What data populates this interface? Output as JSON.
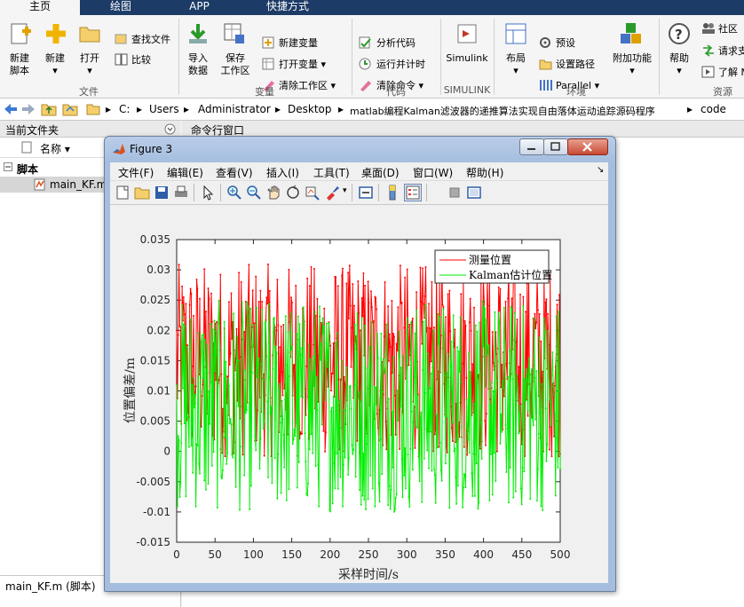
{
  "ribbon_tabs": [
    "主页",
    "绘图",
    "APP",
    "快捷方式"
  ],
  "home": {
    "new_script": [
      "新建",
      "脚本"
    ],
    "new": "新建",
    "open": "打开",
    "find_files": "查找文件",
    "compare": "比较",
    "import": [
      "导入",
      "数据"
    ],
    "save_workspace": [
      "保存",
      "工作区"
    ],
    "new_variable": "新建变量",
    "open_variable": "打开变量",
    "clear_workspace": "清除工作区",
    "analyze_code": "分析代码",
    "run_and_time": "运行并计时",
    "clear_commands": "清除命令",
    "simulink": "Simulink",
    "layout": "布局",
    "preferences": "预设",
    "set_path": "设置路径",
    "parallel": "Parallel",
    "addons": "附加功能",
    "help": "帮助",
    "community": "社区",
    "request_support": "请求支",
    "learn": "了解 M",
    "groups": [
      "文件",
      "变量",
      "代码",
      "SIMULINK",
      "环境",
      "资源"
    ]
  },
  "address": {
    "drive": "C:",
    "crumbs": [
      "Users",
      "Administrator",
      "Desktop",
      "matlab编程Kalman滤波器的递推算法实现自由落体运动追踪源码程序",
      "code"
    ]
  },
  "left_panel": {
    "title": "当前文件夹",
    "column": "名称",
    "group": "脚本",
    "file": "main_KF.m",
    "footer": "main_KF.m  (脚本)"
  },
  "command_window": {
    "title": "命令行窗口"
  },
  "figure": {
    "title": "Figure 3",
    "menu": [
      "文件(F)",
      "编辑(E)",
      "查看(V)",
      "插入(I)",
      "工具(T)",
      "桌面(D)",
      "窗口(W)",
      "帮助(H)"
    ]
  },
  "chart_data": {
    "type": "line",
    "xlabel": "采样时间/s",
    "ylabel": "位置偏差/m",
    "xlim": [
      0,
      500
    ],
    "ylim": [
      -0.015,
      0.035
    ],
    "xticks": [
      0,
      50,
      100,
      150,
      200,
      250,
      300,
      350,
      400,
      450,
      500
    ],
    "yticks": [
      -0.015,
      -0.01,
      -0.005,
      0,
      0.005,
      0.01,
      0.015,
      0.02,
      0.025,
      0.03,
      0.035
    ],
    "grid": false,
    "legend_position": "top-right",
    "series": [
      {
        "name": "测量位置",
        "color": "#ff0000",
        "mean": 0.015,
        "amplitude": 0.016,
        "n": 500
      },
      {
        "name": "Kalman估计位置",
        "color": "#00ee00",
        "mean": 0.0075,
        "amplitude": 0.0175,
        "n": 500
      }
    ]
  }
}
